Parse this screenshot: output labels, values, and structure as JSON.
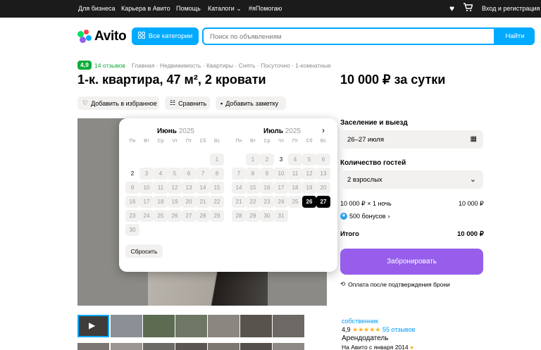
{
  "topbar": {
    "links": [
      "Для бизнеса",
      "Карьера в Авито",
      "Помощь",
      "Каталоги",
      "#яПомогаю"
    ],
    "login": "Вход и регистрация"
  },
  "header": {
    "logo": "Avito",
    "categories_label": "Все категории",
    "search_placeholder": "Поиск по объявлениям",
    "search_button": "Найти"
  },
  "listing": {
    "rating": "4,9",
    "reviews_link": "14 отзывов",
    "breadcrumbs": [
      "Главная",
      "Недвижимость",
      "Квартиры",
      "Снять",
      "Посуточно",
      "1-комнатные"
    ],
    "breadcrumb_separator": "·",
    "title": "1-к. квартира, 47 м², 2 кровати",
    "price": "10 000 ₽ за сутки",
    "actions": {
      "favorite": "Добавить в избранное",
      "compare": "Сравнить",
      "note": "Добавить заметку"
    }
  },
  "calendar": {
    "weekdays": [
      "Пн",
      "Вт",
      "Ср",
      "Чт",
      "Пт",
      "Сб",
      "Вс"
    ],
    "june": {
      "name": "Июнь",
      "year": "2025",
      "rows": [
        [
          "",
          "",
          "",
          "",
          "",
          "",
          "1"
        ],
        [
          "2",
          "3",
          "4",
          "5",
          "6",
          "7",
          "8"
        ],
        [
          "9",
          "10",
          "11",
          "12",
          "13",
          "14",
          "15"
        ],
        [
          "16",
          "17",
          "18",
          "19",
          "20",
          "21",
          "22"
        ],
        [
          "23",
          "24",
          "25",
          "26",
          "27",
          "28",
          "29"
        ],
        [
          "30",
          "",
          "",
          "",
          "",
          "",
          ""
        ]
      ]
    },
    "july": {
      "name": "Июль",
      "year": "2025",
      "rows": [
        [
          "",
          "1",
          "2",
          "3",
          "4",
          "5",
          "6"
        ],
        [
          "7",
          "8",
          "9",
          "10",
          "11",
          "12",
          "13"
        ],
        [
          "14",
          "15",
          "16",
          "17",
          "18",
          "19",
          "20"
        ],
        [
          "21",
          "22",
          "23",
          "24",
          "25",
          "26",
          "27"
        ],
        [
          "28",
          "29",
          "30",
          "31",
          "",
          "",
          ""
        ]
      ]
    },
    "highlight_plain": [
      "june-1-0",
      "july-0-3"
    ],
    "selected": [
      "july-3-5",
      "july-3-6"
    ],
    "reset_label": "Сбросить"
  },
  "booking": {
    "checkin_label": "Заселение и выезд",
    "checkin_value": "26–27 июля",
    "guests_label": "Количество гостей",
    "guests_value": "2 взрослых",
    "nights_line": "10 000 ₽ × 1 ночь",
    "nights_sum": "10 000 ₽",
    "bonus": "500 бонусов",
    "total_label": "Итого",
    "total_value": "10 000 ₽",
    "book_button": "Забронировать",
    "payment_note": "Оплата после подтверждения брони"
  },
  "owner": {
    "name_link": "собственник",
    "rating": "4,9",
    "stars": "★★★★★",
    "reviews_link": "55 отзывов",
    "role": "Арендодатель",
    "since": "На Авито с января 2014"
  },
  "colors": {
    "accent": "#00aaff",
    "book": "#965eeb",
    "rating_badge": "#0dae38"
  }
}
